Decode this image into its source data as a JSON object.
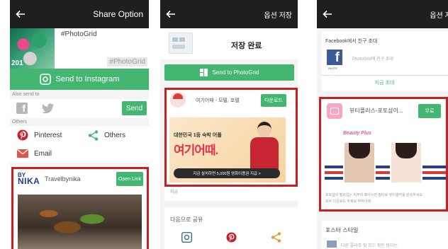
{
  "screen1": {
    "title": "Share Option",
    "hashtag": "#PhotoGrid",
    "hashtag_overlay": "#PhotoGrid",
    "year_overlay": "201",
    "send_instagram_label": "Send to Instagram",
    "also_send_label": "Also send to",
    "send_button": "Send",
    "others_section_label": "Others",
    "pinterest_label": "Pinterest",
    "others_label": "Others",
    "email_label": "Email",
    "ad": {
      "brand_by": "BY",
      "brand_name": "NIKA",
      "account_name": "Travelbynika",
      "open_link": "Open Link"
    }
  },
  "screen2": {
    "title": "옵션 저장",
    "saved_label": "저장 완료",
    "send_photogrid_label": "Send to PhotoGrid",
    "ad": {
      "app_title": "여기어때 - 모텔, 호텔",
      "download_button": "다운로드",
      "banner_line1": "대한민국 1등 숙박 어플",
      "banner_logo": "여기어때.",
      "banner_cta": "지금 설치하면 5,000원 영화이용권 지급 >",
      "desc_tail": "지급"
    },
    "share_more_label": "다음으로 공유"
  },
  "screen3": {
    "title": "옵션 저장",
    "facebook_invite_label": "Facebook에서 친구 초대",
    "facebook_invite_sub": "PhotoGrid에 친구 초대",
    "invite_caption": "INVITE",
    "invite_now": "지금 초대",
    "ad": {
      "app_title": "뷰티플러스-포토샵이...",
      "free_button": "무료",
      "banner_brand": "Beauty Plus",
      "desc": "포토샵이 필요없는 피부의 뽀샤시한 필터로 뷰티셀카를 완성하세요 ",
      "desc2": "모두 다운로드 하세요 부자이에"
    },
    "poster_style_label": "포스터 스타일",
    "poster_style_sub": "다른 콜라주 및 모드 확인 방이는"
  },
  "colors": {
    "accent_green": "#43b771",
    "highlight_red": "#c62020",
    "topbar": "#1f1f1f"
  }
}
